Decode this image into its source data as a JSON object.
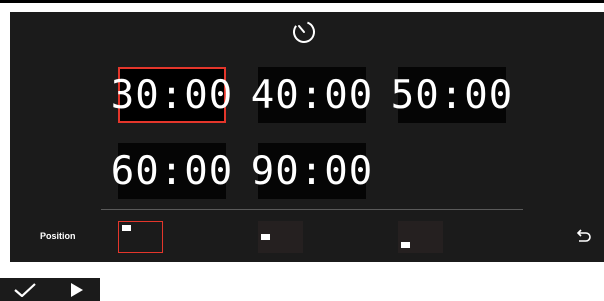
{
  "icons": {
    "timer": "timer-icon",
    "back": "return-arrow-icon",
    "confirm": "checkmark-icon",
    "play": "play-icon"
  },
  "durations": [
    {
      "label": "30:00",
      "selected": true
    },
    {
      "label": "40:00",
      "selected": false
    },
    {
      "label": "50:00",
      "selected": false
    },
    {
      "label": "60:00",
      "selected": false
    },
    {
      "label": "90:00",
      "selected": false
    }
  ],
  "position": {
    "label": "Position",
    "options": [
      "top-left",
      "middle-left",
      "bottom-left"
    ],
    "selected": "top-left"
  },
  "colors": {
    "accent": "#e4362b",
    "panel": "#1b1b1b",
    "tile": "#050505",
    "text": "#ffffff"
  }
}
